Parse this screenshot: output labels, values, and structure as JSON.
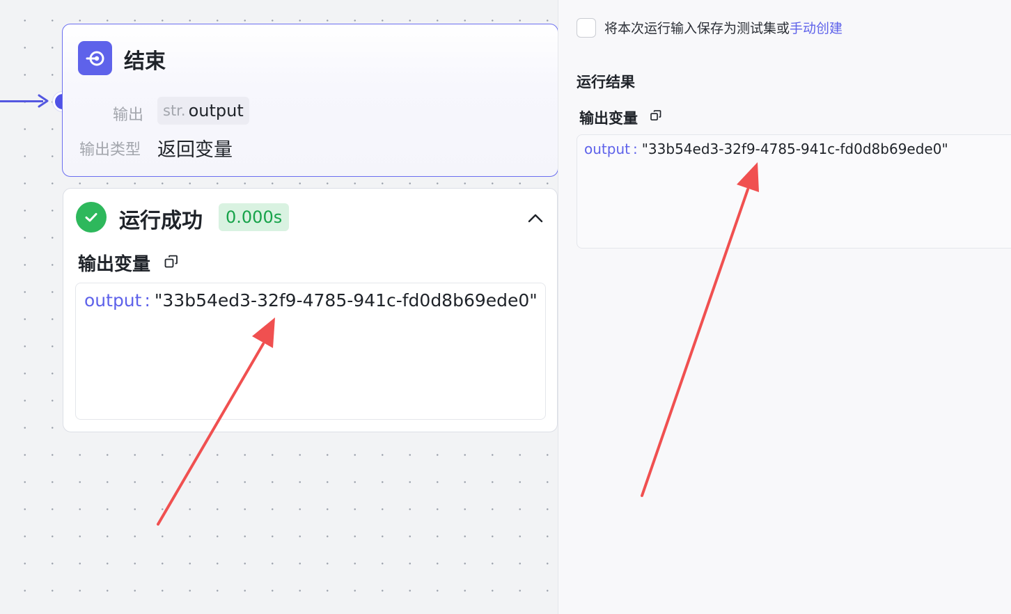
{
  "canvas": {
    "end_node": {
      "title": "结束",
      "icon": "end-node-icon",
      "output_label": "输出",
      "output_var": {
        "type": "str.",
        "name": "output"
      },
      "output_type_label": "输出类型",
      "output_type_value": "返回变量"
    },
    "run_result": {
      "status": "运行成功",
      "duration": "0.000s",
      "output_section_title": "输出变量",
      "output": {
        "key": "output",
        "colon": ":",
        "value": "\"33b54ed3-32f9-4785-941c-fd0d8b69ede0\""
      }
    }
  },
  "panel": {
    "save_checkbox": {
      "checked": false,
      "label": "将本次运行输入保存为测试集或",
      "link": "手动创建"
    },
    "result_title": "运行结果",
    "output_section_title": "输出变量",
    "output": {
      "key": "output",
      "colon": ":",
      "value": "\"33b54ed3-32f9-4785-941c-fd0d8b69ede0\""
    }
  },
  "colors": {
    "accent": "#5e62ea",
    "success": "#2eb85c",
    "annotation_arrow": "#f05050"
  }
}
